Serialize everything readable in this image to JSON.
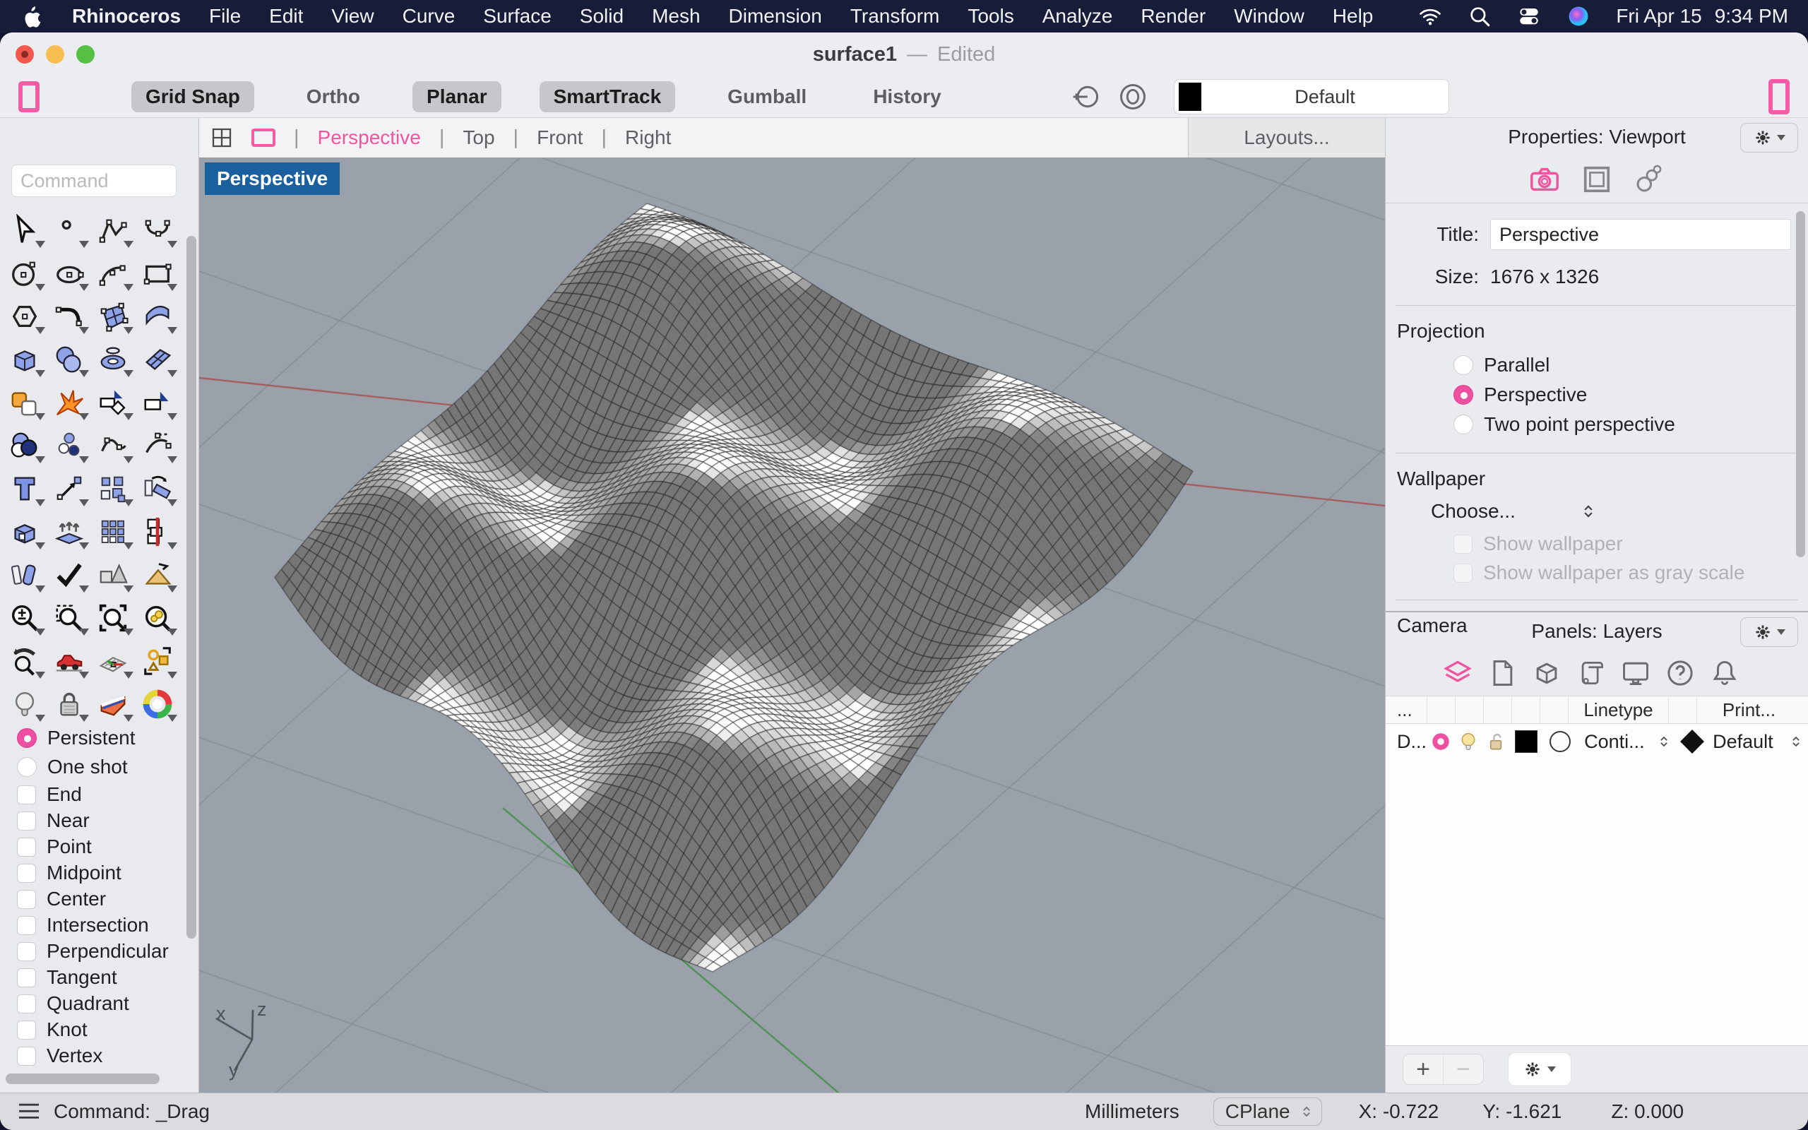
{
  "menu_bar": {
    "items": [
      "Rhinoceros",
      "File",
      "Edit",
      "View",
      "Curve",
      "Surface",
      "Solid",
      "Mesh",
      "Dimension",
      "Transform",
      "Tools",
      "Analyze",
      "Render",
      "Window",
      "Help"
    ],
    "icons": [
      "apple",
      "wifi",
      "spotlight-search",
      "control-center",
      "siri"
    ],
    "date": "Fri Apr 15",
    "time": "9:34 PM"
  },
  "window": {
    "title": "surface1",
    "separator": "—",
    "edited": "Edited"
  },
  "toolbar": {
    "toggles": [
      {
        "label": "Grid Snap",
        "active": true
      },
      {
        "label": "Ortho",
        "active": false
      },
      {
        "label": "Planar",
        "active": true
      },
      {
        "label": "SmartTrack",
        "active": true
      },
      {
        "label": "Gumball",
        "active": false
      },
      {
        "label": "History",
        "active": false
      }
    ],
    "icons": [
      "record-history-circle",
      "concentric-circles"
    ],
    "layer_dropdown_value": "Default"
  },
  "viewport": {
    "tabs": [
      {
        "label": "Perspective",
        "active": true
      },
      {
        "label": "Top",
        "active": false
      },
      {
        "label": "Front",
        "active": false
      },
      {
        "label": "Right",
        "active": false
      }
    ],
    "layouts_label": "Layouts...",
    "badge": "Perspective",
    "axis": {
      "x": "x",
      "y": "y",
      "z": "z"
    }
  },
  "command_panel": {
    "placeholder": "Command"
  },
  "tool_palette": {
    "tools": [
      "cursor-arrow",
      "point-dot",
      "polyline",
      "control-point-curve",
      "circle",
      "ellipse",
      "arc",
      "rectangle",
      "polygon",
      "fillet-corner",
      "surface-patch",
      "curved-surface",
      "box",
      "spheres",
      "torus",
      "twisted-surface",
      "puzzle-pieces",
      "explode-burst",
      "trim-shape",
      "split-shape",
      "boolean-circles",
      "point-cloud",
      "curve-points",
      "extend-curve",
      "text-letter",
      "move-arrow",
      "duplicate-squares",
      "rotate-shape",
      "extrude-box",
      "extrude-surface",
      "grid-array",
      "red-line-trim",
      "fillet-blocks",
      "checkmark",
      "primitive-shapes",
      "pyramid-hand",
      "zoom-plus-minus",
      "zoom-window",
      "zoom-extents",
      "zoom-selected",
      "undo-view",
      "car",
      "cplane-grid",
      "group-shapes",
      "light-bulb",
      "padlock",
      "cake-slice",
      "color-wheel"
    ]
  },
  "osnap": {
    "modes": [
      {
        "label": "Persistent",
        "selected": true
      },
      {
        "label": "One shot",
        "selected": false
      }
    ],
    "snaps": [
      "End",
      "Near",
      "Point",
      "Midpoint",
      "Center",
      "Intersection",
      "Perpendicular",
      "Tangent",
      "Quadrant",
      "Knot",
      "Vertex"
    ]
  },
  "properties_panel": {
    "header": "Properties: Viewport",
    "tab_icons": [
      "camera",
      "viewport-frame",
      "link-chain"
    ],
    "title_label": "Title:",
    "title_value": "Perspective",
    "size_label": "Size:",
    "size_value": "1676 x 1326",
    "projection": {
      "heading": "Projection",
      "options": [
        {
          "label": "Parallel",
          "selected": false
        },
        {
          "label": "Perspective",
          "selected": true
        },
        {
          "label": "Two point perspective",
          "selected": false
        }
      ]
    },
    "wallpaper": {
      "heading": "Wallpaper",
      "choose": "Choose...",
      "options": [
        {
          "label": "Show wallpaper",
          "checked": false,
          "disabled": true
        },
        {
          "label": "Show wallpaper as gray scale",
          "checked": false,
          "disabled": true
        }
      ]
    },
    "camera_heading": "Camera"
  },
  "layers_panel": {
    "header": "Panels: Layers",
    "icons": [
      "layers",
      "page",
      "box",
      "scroll",
      "display",
      "help",
      "bell"
    ],
    "columns": {
      "name": "...",
      "linetype": "Linetype",
      "print": "Print..."
    },
    "rows": [
      {
        "name": "D...",
        "icons": [
          "current-layer-dot",
          "bulb-on",
          "unlocked-padlock",
          "color-swatch-black",
          "material-circle"
        ],
        "linetype": "Conti...",
        "print_width": "Default"
      }
    ]
  },
  "status_bar": {
    "command": "Command: _Drag",
    "units": "Millimeters",
    "cplane": "CPlane",
    "coords": {
      "x": "X: -0.722",
      "y": "Y: -1.621",
      "z": "Z: 0.000"
    }
  },
  "colors": {
    "accent_pink": "#ee4fa0",
    "badge_blue": "#1a609f",
    "viewport_gray": "#9aa1aa",
    "menubar": "#171c38"
  }
}
